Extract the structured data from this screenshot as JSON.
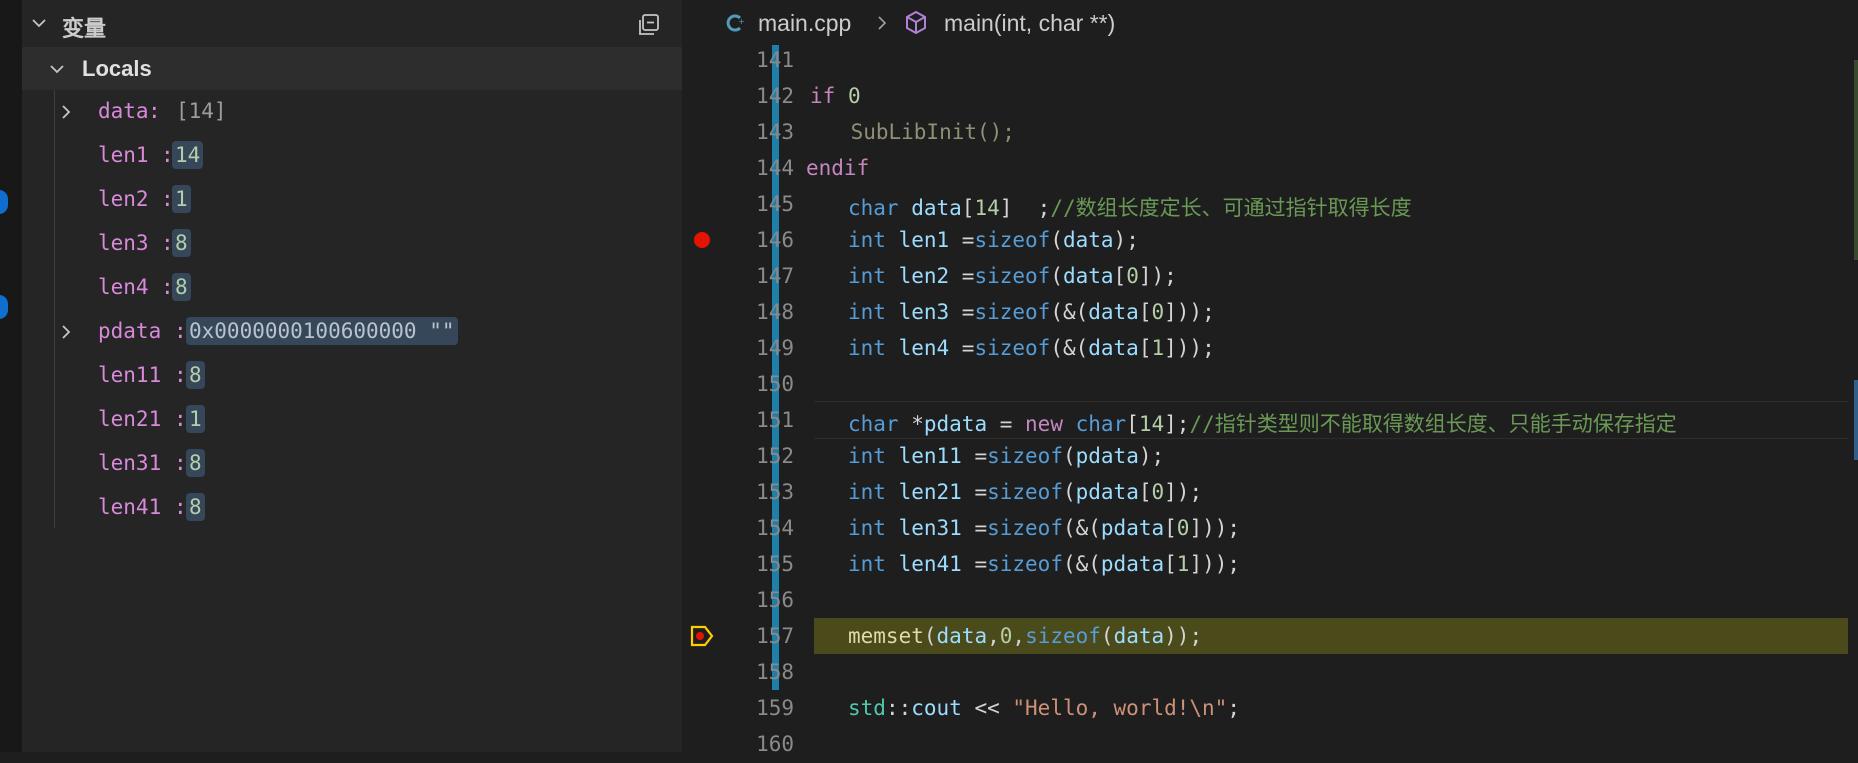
{
  "variables_panel": {
    "title": "变量",
    "section": "Locals",
    "items": [
      {
        "name": "data",
        "sep": ":",
        "value": "[14]",
        "expandable": true
      },
      {
        "name": "len1",
        "sep": ":",
        "value": "14",
        "expandable": false
      },
      {
        "name": "len2",
        "sep": ":",
        "value": "1",
        "expandable": false
      },
      {
        "name": "len3",
        "sep": ":",
        "value": "8",
        "expandable": false
      },
      {
        "name": "len4",
        "sep": ":",
        "value": "8",
        "expandable": false
      },
      {
        "name": "pdata",
        "sep": ":",
        "value": "0x0000000100600000 \"\"",
        "expandable": true
      },
      {
        "name": "len11",
        "sep": ":",
        "value": "8",
        "expandable": false
      },
      {
        "name": "len21",
        "sep": ":",
        "value": "1",
        "expandable": false
      },
      {
        "name": "len31",
        "sep": ":",
        "value": "8",
        "expandable": false
      },
      {
        "name": "len41",
        "sep": ":",
        "value": "8",
        "expandable": false
      }
    ]
  },
  "editor": {
    "breadcrumb": {
      "file": "main.cpp",
      "symbol": "main(int, char **)"
    },
    "line_numbers": [
      "141",
      "142",
      "143",
      "144",
      "145",
      "146",
      "147",
      "148",
      "149",
      "150",
      "151",
      "152",
      "153",
      "154",
      "155",
      "156",
      "157",
      "158",
      "159",
      "160"
    ],
    "code": {
      "l142": {
        "a": "if",
        "b": " ",
        "c": "0"
      },
      "l143": {
        "a": "    ",
        "b": "SubLibInit",
        "c": "();"
      },
      "l144": {
        "a": "endif"
      },
      "l145": {
        "a": "char",
        "b": " data",
        "c": "[",
        "d": "14",
        "e": "]  ;",
        "f": "//数组长度定长、可通过指针取得长度"
      },
      "l146": {
        "a": "int",
        "b": " len1 ",
        "c": "=",
        "d": "sizeof",
        "e": "(",
        "f": "data",
        "g": ");"
      },
      "l147": {
        "a": "int",
        "b": " len2 ",
        "c": "=",
        "d": "sizeof",
        "e": "(",
        "f": "data",
        "g": "[",
        "h": "0",
        "i": "]);"
      },
      "l148": {
        "a": "int",
        "b": " len3 ",
        "c": "=",
        "d": "sizeof",
        "e": "(&(",
        "f": "data",
        "g": "[",
        "h": "0",
        "i": "]));"
      },
      "l149": {
        "a": "int",
        "b": " len4 ",
        "c": "=",
        "d": "sizeof",
        "e": "(&(",
        "f": "data",
        "g": "[",
        "h": "1",
        "i": "]));"
      },
      "l151": {
        "a": "char",
        "b": " *",
        "c": "pdata",
        "d": " = ",
        "e": "new",
        "f": " ",
        "g": "char",
        "h": "[",
        "i": "14",
        "j": "];",
        "k": "//指针类型则不能取得数组长度、只能手动保存指定"
      },
      "l152": {
        "a": "int",
        "b": " len11 ",
        "c": "=",
        "d": "sizeof",
        "e": "(",
        "f": "pdata",
        "g": ");"
      },
      "l153": {
        "a": "int",
        "b": " len21 ",
        "c": "=",
        "d": "sizeof",
        "e": "(",
        "f": "pdata",
        "g": "[",
        "h": "0",
        "i": "]);"
      },
      "l154": {
        "a": "int",
        "b": " len31 ",
        "c": "=",
        "d": "sizeof",
        "e": "(&(",
        "f": "pdata",
        "g": "[",
        "h": "0",
        "i": "]));"
      },
      "l155": {
        "a": "int",
        "b": " len41 ",
        "c": "=",
        "d": "sizeof",
        "e": "(&(",
        "f": "pdata",
        "g": "[",
        "h": "1",
        "i": "]));"
      },
      "l157": {
        "a": "memset",
        "b": "(",
        "c": "data",
        "d": ",",
        "e": "0",
        "f": ",",
        "g": "sizeof",
        "h": "(",
        "i": "data",
        "j": "));"
      },
      "l159": {
        "a": "std",
        "b": "::",
        "c": "cout",
        "d": " << ",
        "e": "\"Hello, world!\\n\"",
        "f": ";"
      }
    }
  }
}
